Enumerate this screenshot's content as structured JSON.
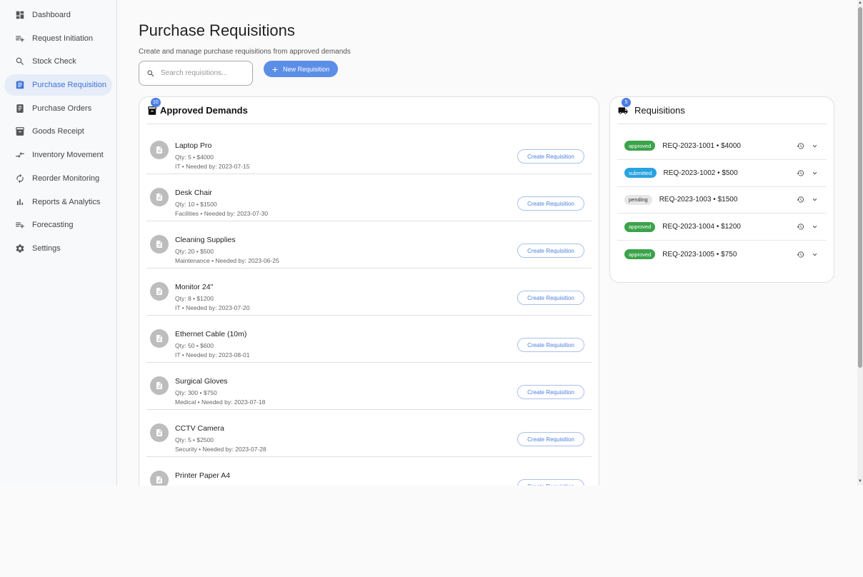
{
  "sidebar": {
    "items": [
      {
        "label": "Dashboard",
        "icon": "dashboard-icon"
      },
      {
        "label": "Request Initiation",
        "icon": "playlist-add-icon"
      },
      {
        "label": "Stock Check",
        "icon": "search-icon"
      },
      {
        "label": "Purchase Requisition",
        "icon": "assignment-icon",
        "active": true
      },
      {
        "label": "Purchase Orders",
        "icon": "receipt-icon"
      },
      {
        "label": "Goods Receipt",
        "icon": "archive-icon"
      },
      {
        "label": "Inventory Movement",
        "icon": "compare-arrows-icon"
      },
      {
        "label": "Reorder Monitoring",
        "icon": "autorenew-icon"
      },
      {
        "label": "Reports & Analytics",
        "icon": "bar-chart-icon"
      },
      {
        "label": "Forecasting",
        "icon": "playlist-add-icon"
      },
      {
        "label": "Settings",
        "icon": "gear-icon"
      }
    ]
  },
  "header": {
    "title": "Purchase Requisitions",
    "subtitle": "Create and manage purchase requisitions from approved demands"
  },
  "search": {
    "placeholder": "Search requisitions..."
  },
  "toolbar": {
    "new_label": "New Requisition"
  },
  "demands": {
    "title": "Approved Demands",
    "count": "10",
    "action_label": "Create Requisition",
    "items": [
      {
        "name": "Laptop Pro",
        "qty": "Qty: 5 • $4000",
        "meta": "IT • Needed by: 2023-07-15"
      },
      {
        "name": "Desk Chair",
        "qty": "Qty: 10 • $1500",
        "meta": "Facilities • Needed by: 2023-07-30"
      },
      {
        "name": "Cleaning Supplies",
        "qty": "Qty: 20 • $500",
        "meta": "Maintenance • Needed by: 2023-06-25"
      },
      {
        "name": "Monitor 24\"",
        "qty": "Qty: 8 • $1200",
        "meta": "IT • Needed by: 2023-07-20"
      },
      {
        "name": "Ethernet Cable (10m)",
        "qty": "Qty: 50 • $600",
        "meta": "IT • Needed by: 2023-08-01"
      },
      {
        "name": "Surgical Gloves",
        "qty": "Qty: 300 • $750",
        "meta": "Medical • Needed by: 2023-07-18"
      },
      {
        "name": "CCTV Camera",
        "qty": "Qty: 5 • $2500",
        "meta": "Security • Needed by: 2023-07-28"
      },
      {
        "name": "Printer Paper A4",
        "qty": "",
        "meta": ""
      }
    ]
  },
  "requisitions": {
    "title": "Requisitions",
    "count": "5",
    "items": [
      {
        "status": "approved",
        "text": "REQ-2023-1001 • $4000"
      },
      {
        "status": "submitted",
        "text": "REQ-2023-1002 • $500"
      },
      {
        "status": "pending",
        "text": "REQ-2023-1003 • $1500"
      },
      {
        "status": "approved",
        "text": "REQ-2023-1004 • $1200"
      },
      {
        "status": "approved",
        "text": "REQ-2023-1005 • $750"
      }
    ]
  },
  "colors": {
    "accent": "#4d7fe0",
    "approved": "#3ba34a",
    "submitted": "#29a3e0",
    "pending": "#e6e6e6"
  }
}
